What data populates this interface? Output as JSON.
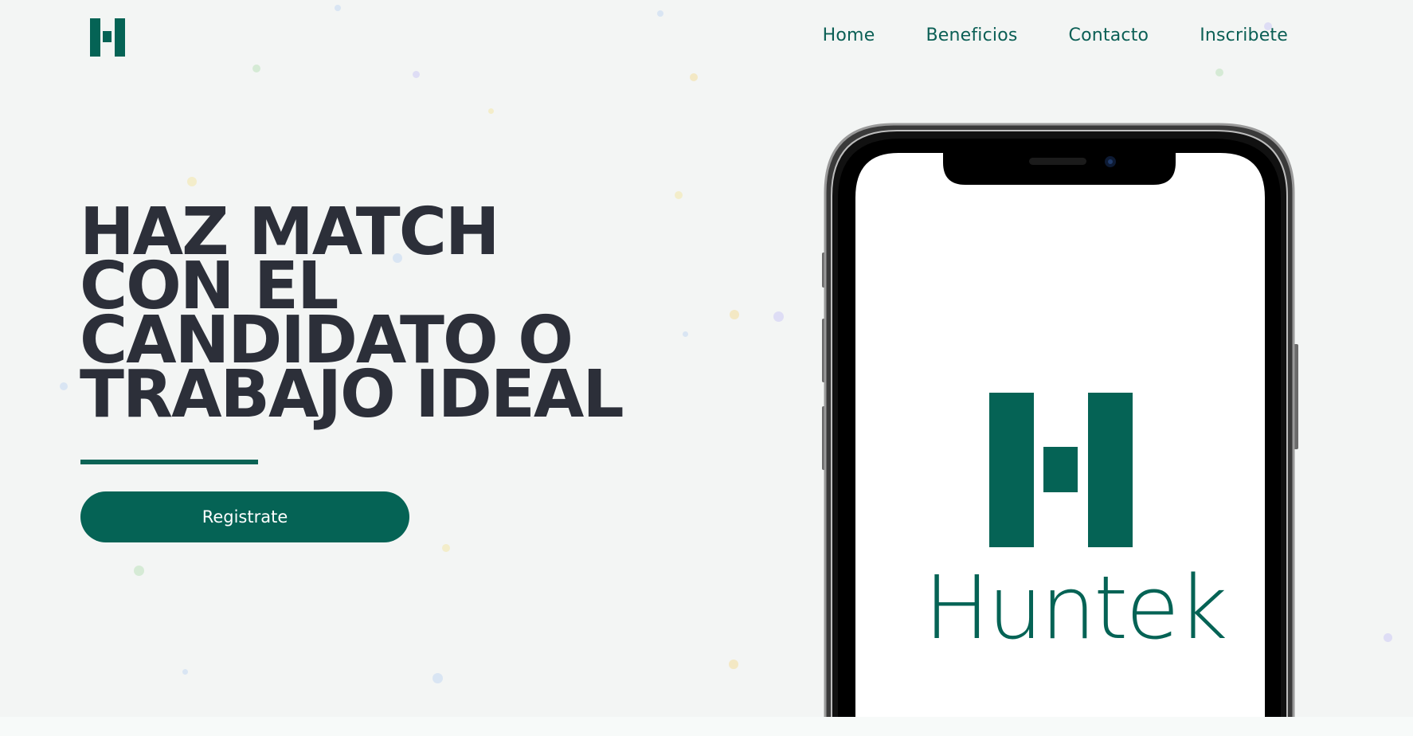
{
  "brand": {
    "name": "Huntek",
    "logo_icon": "huntek-h-logo-icon",
    "color": "#056355"
  },
  "nav": {
    "items": [
      {
        "label": "Home"
      },
      {
        "label": "Beneficios"
      },
      {
        "label": "Contacto"
      },
      {
        "label": "Inscribete"
      }
    ]
  },
  "hero": {
    "headline_lines": [
      "HAZ MATCH",
      "CON EL",
      "CANDIDATO O",
      "TRABAJO IDEAL"
    ],
    "cta_label": "Registrate"
  },
  "phone_screen": {
    "app_name": "Huntek",
    "logo_icon": "huntek-h-logo-icon"
  },
  "colors": {
    "accent": "#056355",
    "headline": "#2c2f39",
    "background": "#f3f5f4"
  }
}
